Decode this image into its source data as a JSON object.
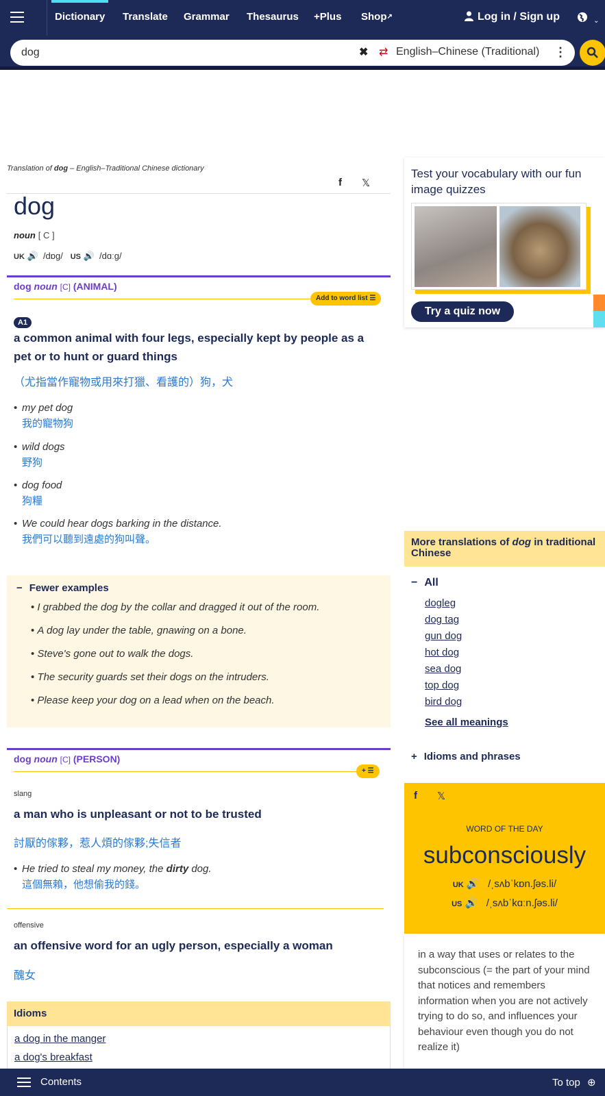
{
  "nav": {
    "links": [
      "Dictionary",
      "Translate",
      "Grammar",
      "Thesaurus",
      "+Plus",
      "Shop"
    ],
    "login": "Log in / Sign up"
  },
  "search": {
    "value": "dog",
    "language": "English–Chinese (Traditional)"
  },
  "entry": {
    "translation_of_prefix": "Translation of",
    "translation_of_word": "dog",
    "translation_of_suffix": "– English–Traditional Chinese dictionary",
    "headword": "dog",
    "pos": "noun",
    "grammar": "[ C ]",
    "uk_label": "UK",
    "uk_ipa": "/dɒɡ/",
    "us_label": "US",
    "us_ipa": "/dɑːɡ/"
  },
  "sense1": {
    "word": "dog",
    "pos": "noun",
    "gram": "[C]",
    "guide": "(ANIMAL)",
    "add_label": "Add to word list",
    "level": "A1",
    "definition": "a common animal with four legs, especially kept by people as a pet or to hunt or guard things",
    "translation": "（尤指當作寵物或用來打獵、看護的）狗，犬",
    "examples": [
      {
        "en": "my pet dog",
        "zh": "我的寵物狗"
      },
      {
        "en": "wild dogs",
        "zh": "野狗"
      },
      {
        "en": "dog food",
        "zh": "狗糧"
      },
      {
        "en": "We could hear dogs barking in the distance.",
        "zh": "我們可以聽到遠處的狗叫聲。"
      }
    ],
    "fewer_label": "Fewer examples",
    "more_examples": [
      "I grabbed the dog by the collar and dragged it out of the room.",
      "A dog lay under the table, gnawing on a bone.",
      "Steve's gone out to walk the dogs.",
      "The security guards set their dogs on the intruders.",
      "Please keep your dog on a lead when on the beach."
    ]
  },
  "sense2": {
    "word": "dog",
    "pos": "noun",
    "gram": "[C]",
    "guide": "(PERSON)",
    "register1": "slang",
    "definition1": "a man who is unpleasant or not to be trusted",
    "translation1": "討厭的傢夥，惹人煩的傢夥;失信者",
    "example_pre": "He tried to steal my money, the",
    "example_bold": "dirty",
    "example_post": "dog.",
    "example_zh": "這個無賴，他想偷我的錢。",
    "register2": "offensive",
    "definition2": "an offensive word for an ugly person, especially a woman",
    "translation2": "醜女"
  },
  "idioms": {
    "title": "Idioms",
    "items": [
      "a dog in the manger",
      "a dog's breakfast"
    ]
  },
  "quiz": {
    "title": "Test your vocabulary with our fun image quizzes",
    "button": "Try a quiz now"
  },
  "more_translations": {
    "title_prefix": "More translations of",
    "title_word": "dog",
    "title_suffix": "in traditional Chinese",
    "all_label": "All",
    "links": [
      "dogleg",
      "dog tag",
      "gun dog",
      "hot dog",
      "sea dog",
      "top dog",
      "bird dog"
    ],
    "see_all": "See all meanings",
    "idioms_phrases": "Idioms and phrases"
  },
  "wotd": {
    "label": "WORD OF THE DAY",
    "word": "subconsciously",
    "uk_label": "UK",
    "uk_ipa": "/ˌsʌbˈkɒn.ʃəs.li/",
    "us_label": "US",
    "us_ipa": "/ˌsʌbˈkɑːn.ʃəs.li/",
    "definition": "in a way that uses or relates to the subconscious (= the part of your mind that notices and remembers information when you are not actively trying to do so, and influences your behaviour even though you do not realize it)"
  },
  "bottom": {
    "contents": "Contents",
    "to_top": "To top"
  }
}
